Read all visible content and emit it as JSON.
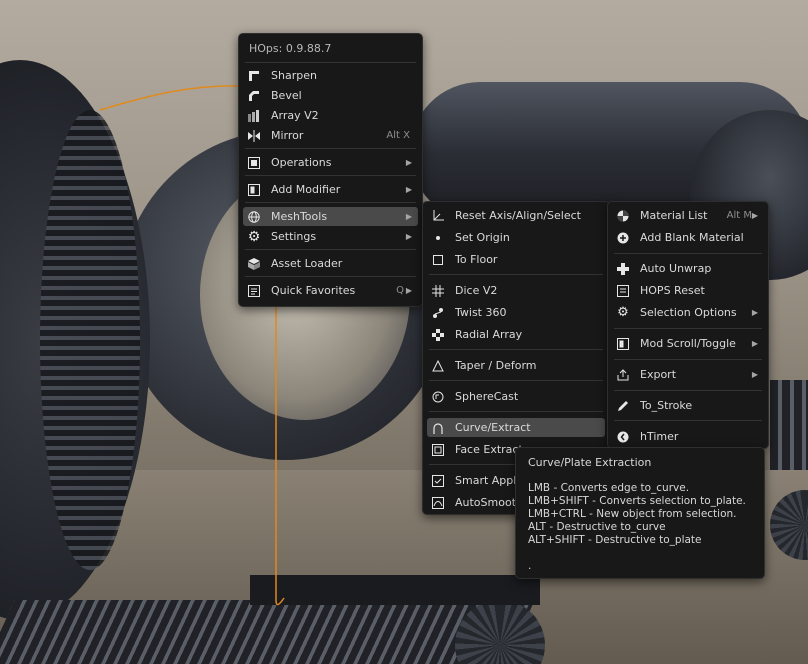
{
  "main_menu": {
    "header": "HOps: 0.9.88.7",
    "items": [
      {
        "label": "Sharpen",
        "icon": "sharpen-icon"
      },
      {
        "label": "Bevel",
        "icon": "bevel-icon"
      },
      {
        "label": "Array V2",
        "icon": "array-icon"
      },
      {
        "label": "Mirror",
        "icon": "mirror-icon",
        "shortcut": "Alt X"
      },
      {
        "label": "Operations",
        "icon": "operations-icon",
        "submenu": true
      },
      {
        "label": "Add Modifier",
        "icon": "add-modifier-icon",
        "submenu": true
      },
      {
        "label": "MeshTools",
        "icon": "meshtools-icon",
        "submenu": true,
        "active": true
      },
      {
        "label": "Settings",
        "icon": "gear-icon",
        "submenu": true
      },
      {
        "label": "Asset Loader",
        "icon": "asset-loader-icon"
      },
      {
        "label": "Quick Favorites",
        "icon": "favorites-icon",
        "shortcut": "Q"
      }
    ]
  },
  "meshtools_menu": {
    "items": [
      {
        "label": "Reset Axis/Align/Select",
        "icon": "reset-axis-icon"
      },
      {
        "label": "Set Origin",
        "icon": "dot-icon"
      },
      {
        "label": "To Floor",
        "icon": "square-icon"
      },
      {
        "label": "Dice V2",
        "icon": "dice-icon"
      },
      {
        "label": "Twist 360",
        "icon": "twist-icon"
      },
      {
        "label": "Radial Array",
        "icon": "radial-array-icon"
      },
      {
        "label": "Taper / Deform",
        "icon": "taper-icon"
      },
      {
        "label": "SphereCast",
        "icon": "spherecast-icon"
      },
      {
        "label": "Curve/Extract",
        "icon": "curve-icon",
        "active": true
      },
      {
        "label": "Face Extract",
        "icon": "face-extract-icon"
      },
      {
        "label": "Smart Apply",
        "icon": "smart-apply-icon"
      },
      {
        "label": "AutoSmooth",
        "icon": "autosmooth-icon"
      }
    ]
  },
  "right_menu": {
    "items": [
      {
        "label": "Material List",
        "icon": "material-icon",
        "shortcut": "Alt M"
      },
      {
        "label": "Add Blank Material",
        "icon": "plus-circle-icon"
      },
      {
        "label": "Auto Unwrap",
        "icon": "unwrap-icon"
      },
      {
        "label": "HOPS Reset",
        "icon": "hops-reset-icon"
      },
      {
        "label": "Selection Options",
        "icon": "selection-options-icon",
        "submenu": true
      },
      {
        "label": "Mod Scroll/Toggle",
        "icon": "mod-scroll-icon",
        "submenu": true
      },
      {
        "label": "Export",
        "icon": "export-icon",
        "submenu": true
      },
      {
        "label": "To_Stroke",
        "icon": "pencil-icon"
      },
      {
        "label": "hTimer",
        "icon": "timer-icon"
      }
    ]
  },
  "tooltip": {
    "title": "Curve/Plate Extraction",
    "lines": [
      "LMB - Converts edge to_curve.",
      "LMB+SHIFT - Converts selection to_plate.",
      "LMB+CTRL - New object from selection.",
      "ALT - Destructive to_curve",
      "ALT+SHIFT - Destructive to_plate",
      "",
      "."
    ]
  },
  "colors": {
    "menu_bg": "#181818",
    "highlight": "#4a4a4a",
    "wire": "#e08a1e"
  }
}
